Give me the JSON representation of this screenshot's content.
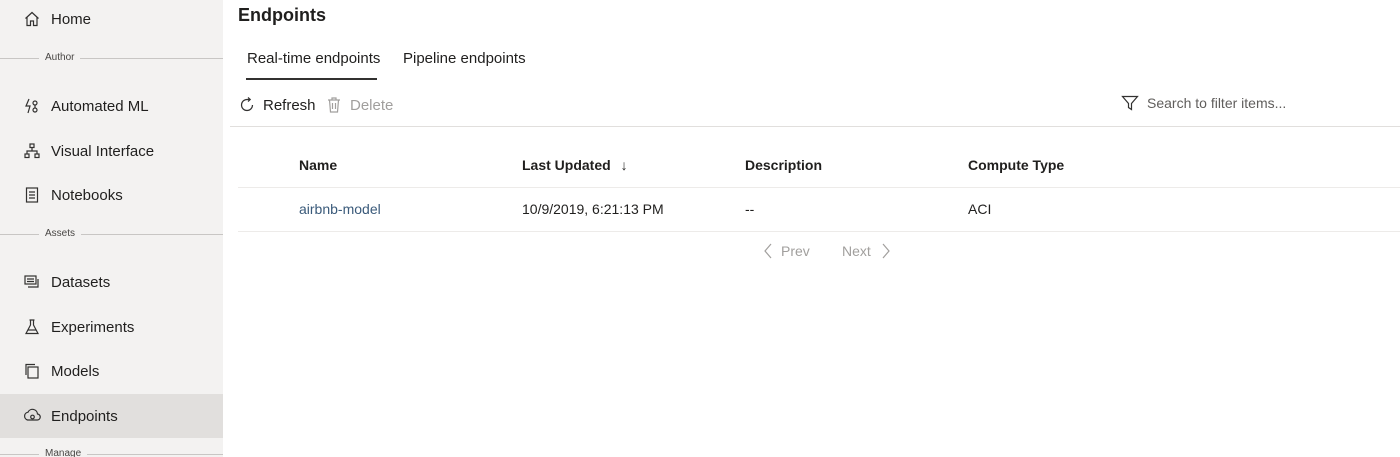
{
  "sidebar": {
    "home": "Home",
    "sections": {
      "author": "Author",
      "assets": "Assets",
      "manage": "Manage"
    },
    "items": [
      {
        "label": "Automated ML",
        "icon": "automated-ml-icon"
      },
      {
        "label": "Visual Interface",
        "icon": "visual-interface-icon"
      },
      {
        "label": "Notebooks",
        "icon": "notebook-icon"
      },
      {
        "label": "Datasets",
        "icon": "datasets-icon"
      },
      {
        "label": "Experiments",
        "icon": "flask-icon"
      },
      {
        "label": "Models",
        "icon": "models-icon"
      },
      {
        "label": "Endpoints",
        "icon": "endpoints-icon"
      }
    ],
    "active": "Endpoints"
  },
  "main": {
    "title": "Endpoints",
    "tabs": [
      {
        "label": "Real-time endpoints",
        "selected": true
      },
      {
        "label": "Pipeline endpoints",
        "selected": false
      }
    ],
    "toolbar": {
      "refresh": "Refresh",
      "delete": "Delete",
      "search_placeholder": "Search to filter items..."
    },
    "table": {
      "columns": [
        "Name",
        "Last Updated",
        "Description",
        "Compute Type"
      ],
      "sort_indicator": "↓",
      "rows": [
        {
          "name": "airbnb-model",
          "last_updated": "10/9/2019, 6:21:13 PM",
          "description": "--",
          "compute_type": "ACI"
        }
      ]
    },
    "pager": {
      "prev": "Prev",
      "next": "Next"
    }
  },
  "colors": {
    "sidebar_bg": "#f3f2f1",
    "active_bg": "#e1dfdd",
    "link": "#3a5a7a",
    "disabled": "#a19f9d"
  }
}
